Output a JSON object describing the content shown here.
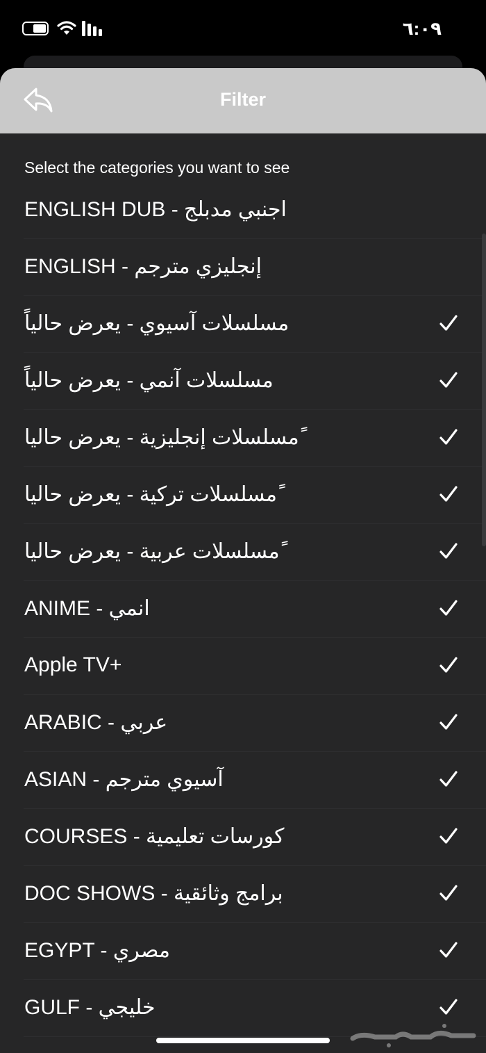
{
  "status": {
    "time": "٦:٠٩"
  },
  "nav": {
    "title": "Filter",
    "back_icon": "reply-back-icon"
  },
  "subtitle": "Select the categories you want to see",
  "categories": [
    {
      "label": "ENGLISH DUB - اجنبي مدبلج",
      "checked": false
    },
    {
      "label": "ENGLISH - إنجليزي مترجم",
      "checked": false
    },
    {
      "label": "مسلسلات آسيوي - يعرض حالياً",
      "checked": true
    },
    {
      "label": "مسلسلات آنمي - يعرض حالياً",
      "checked": true
    },
    {
      "label": "ًمسلسلات إنجليزية - يعرض حاليا",
      "checked": true
    },
    {
      "label": "ًمسلسلات تركية - يعرض حاليا",
      "checked": true
    },
    {
      "label": "ًمسلسلات عربية - يعرض حاليا",
      "checked": true
    },
    {
      "label": "ANIME - انمي",
      "checked": true
    },
    {
      "label": "Apple TV+",
      "checked": true
    },
    {
      "label": "ARABIC - عربي",
      "checked": true
    },
    {
      "label": "ASIAN - آسيوي مترجم",
      "checked": true
    },
    {
      "label": "COURSES - كورسات تعليمية",
      "checked": true
    },
    {
      "label": "DOC SHOWS - برامج وثائقية",
      "checked": true
    },
    {
      "label": "EGYPT - مصري",
      "checked": true
    },
    {
      "label": "GULF - خليجي",
      "checked": true
    }
  ],
  "colors": {
    "sheet_background": "#262627",
    "nav_background": "#c9c9c9",
    "text": "#ffffff"
  }
}
